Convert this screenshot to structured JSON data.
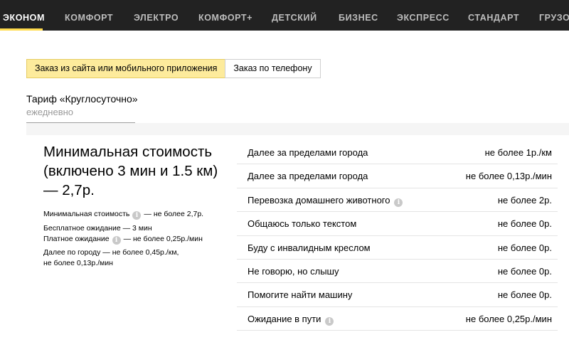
{
  "nav": {
    "items": [
      "ЭКОНОМ",
      "КОМФОРТ",
      "ЭЛЕКТРО",
      "КОМФОРТ+",
      "ДЕТСКИЙ",
      "БИЗНЕС",
      "ЭКСПРЕСС",
      "СТАНДАРТ",
      "ГРУЗОВОЙ"
    ],
    "active_index": 0,
    "accent_color": "#ffdb4d"
  },
  "order_tabs": [
    {
      "label": "Заказ из сайта или мобильного приложения",
      "active": true
    },
    {
      "label": "Заказ по телефону",
      "active": false
    }
  ],
  "tariff": {
    "title": "Тариф «Круглосуточно»",
    "schedule": "ежедневно"
  },
  "summary": {
    "title": "Минимальная стоимость (включено 3 мин и 1.5 км) — 2,7р.",
    "details": [
      {
        "label": "Минимальная стоимость",
        "info_icon": true,
        "value": "— не более 2,7р."
      },
      {
        "label": "Бесплатное ожидание — 3 мин",
        "info_icon": false,
        "value": ""
      },
      {
        "label": "Платное ожидание",
        "info_icon": true,
        "value": "— не более 0,25р./мин"
      },
      {
        "label": "Далее по городу — не более 0,45р./км,",
        "info_icon": false,
        "value": ""
      },
      {
        "label": "не более 0,13р./мин",
        "info_icon": false,
        "value": ""
      }
    ]
  },
  "prices": [
    {
      "label": "Далее за пределами города",
      "info_icon": false,
      "value": "не более 1р./км"
    },
    {
      "label": "Далее за пределами города",
      "info_icon": false,
      "value": "не более 0,13р./мин"
    },
    {
      "label": "Перевозка домашнего животного",
      "info_icon": true,
      "value": "не более 2р."
    },
    {
      "label": "Общаюсь только текстом",
      "info_icon": false,
      "value": "не более 0р."
    },
    {
      "label": "Буду с инвалидным креслом",
      "info_icon": false,
      "value": "не более 0р."
    },
    {
      "label": "Не говорю, но слышу",
      "info_icon": false,
      "value": "не более 0р."
    },
    {
      "label": "Помогите найти машину",
      "info_icon": false,
      "value": "не более 0р."
    },
    {
      "label": "Ожидание в пути",
      "info_icon": true,
      "value": "не более 0,25р./мин"
    }
  ]
}
